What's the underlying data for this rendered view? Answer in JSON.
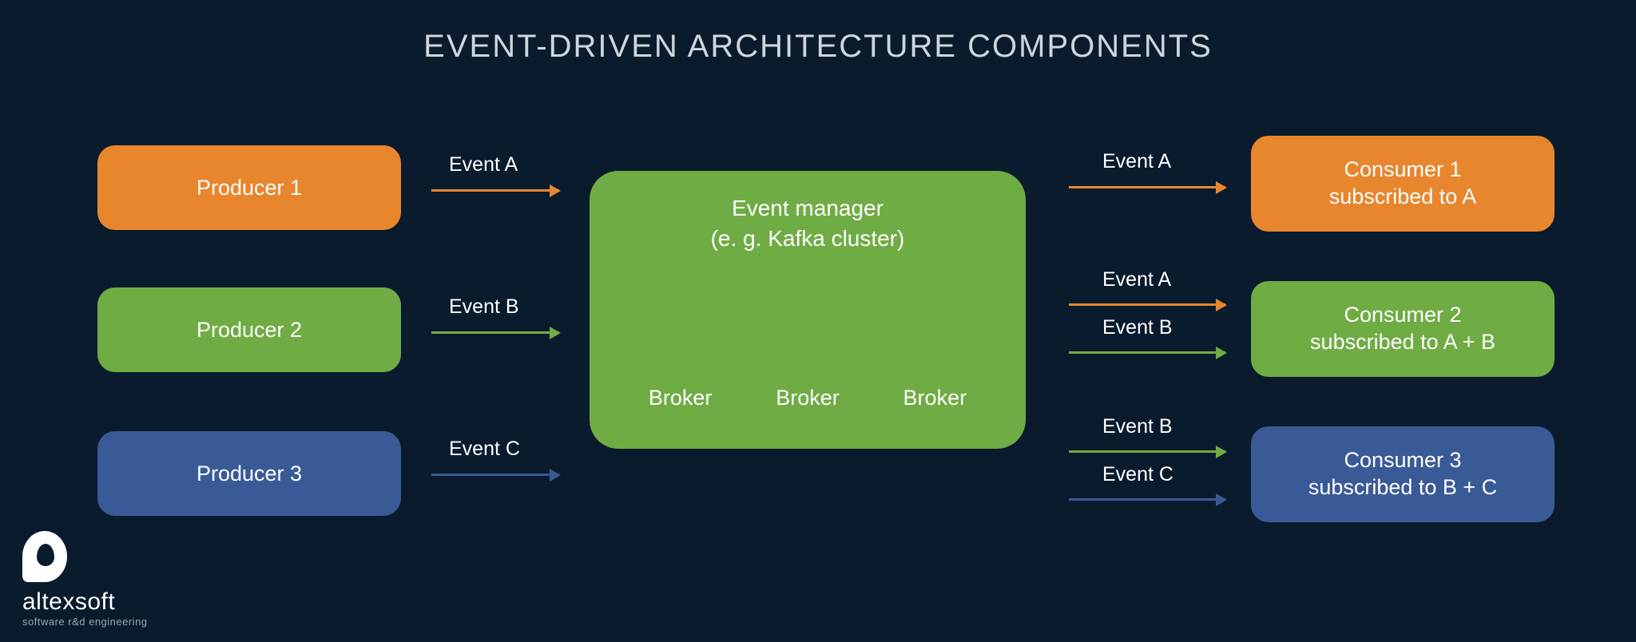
{
  "title": "EVENT-DRIVEN ARCHITECTURE COMPONENTS",
  "producers": [
    {
      "label": "Producer 1",
      "event": "Event A"
    },
    {
      "label": "Producer 2",
      "event": "Event B"
    },
    {
      "label": "Producer 3",
      "event": "Event C"
    }
  ],
  "manager": {
    "title_l1": "Event manager",
    "title_l2": "(e. g. Kafka cluster)",
    "brokers": [
      "Broker",
      "Broker",
      "Broker"
    ]
  },
  "rightEvents": {
    "c1": [
      "Event A"
    ],
    "c2": [
      "Event A",
      "Event B"
    ],
    "c3": [
      "Event B",
      "Event C"
    ]
  },
  "consumers": [
    {
      "l1": "Consumer 1",
      "l2": "subscribed to A"
    },
    {
      "l1": "Consumer 2",
      "l2": "subscribed to A + B"
    },
    {
      "l1": "Consumer 3",
      "l2": "subscribed to B + C"
    }
  ],
  "logo": {
    "name": "altexsoft",
    "tag": "software r&d engineering"
  }
}
